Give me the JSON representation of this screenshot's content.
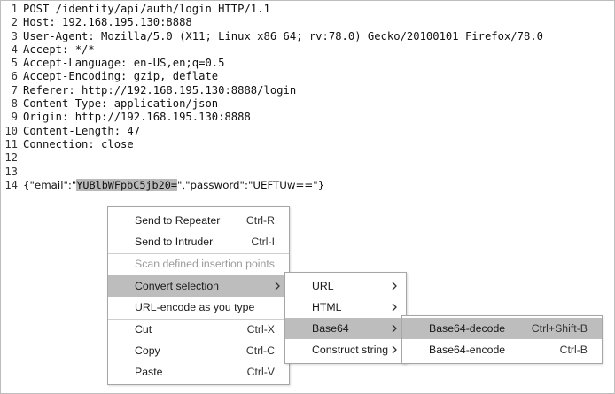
{
  "request_lines": [
    {
      "num": "1",
      "text": "POST /identity/api/auth/login HTTP/1.1"
    },
    {
      "num": "2",
      "text": "Host: 192.168.195.130:8888"
    },
    {
      "num": "3",
      "text": "User-Agent: Mozilla/5.0 (X11; Linux x86_64; rv:78.0) Gecko/20100101 Firefox/78.0"
    },
    {
      "num": "4",
      "text": "Accept: */*"
    },
    {
      "num": "5",
      "text": "Accept-Language: en-US,en;q=0.5"
    },
    {
      "num": "6",
      "text": "Accept-Encoding: gzip, deflate"
    },
    {
      "num": "7",
      "text": "Referer: http://192.168.195.130:8888/login"
    },
    {
      "num": "8",
      "text": "Content-Type: application/json"
    },
    {
      "num": "9",
      "text": "Origin: http://192.168.195.130:8888"
    },
    {
      "num": "10",
      "text": "Content-Length: 47"
    },
    {
      "num": "11",
      "text": "Connection: close"
    },
    {
      "num": "12",
      "text": ""
    },
    {
      "num": "13",
      "text": ""
    }
  ],
  "body_line": {
    "num": "14",
    "prefix": "{\"email\":\"",
    "selected": "YUBlbWFpbC5jb20=",
    "suffix": "\",\"password\":\"UEFTUw==\"}"
  },
  "context_menu": {
    "send_to_repeater": {
      "label": "Send to Repeater",
      "shortcut": "Ctrl-R"
    },
    "send_to_intruder": {
      "label": "Send to Intruder",
      "shortcut": "Ctrl-I"
    },
    "scan_insertion": {
      "label": "Scan defined insertion points"
    },
    "convert_selection": {
      "label": "Convert selection"
    },
    "url_encode_as_type": {
      "label": "URL-encode as you type"
    },
    "cut": {
      "label": "Cut",
      "shortcut": "Ctrl-X"
    },
    "copy": {
      "label": "Copy",
      "shortcut": "Ctrl-C"
    },
    "paste": {
      "label": "Paste",
      "shortcut": "Ctrl-V"
    }
  },
  "convert_submenu": {
    "url": {
      "label": "URL"
    },
    "html": {
      "label": "HTML"
    },
    "base64": {
      "label": "Base64"
    },
    "construct_string": {
      "label": "Construct string"
    }
  },
  "base64_submenu": {
    "decode": {
      "label": "Base64-decode",
      "shortcut": "Ctrl+Shift-B"
    },
    "encode": {
      "label": "Base64-encode",
      "shortcut": "Ctrl-B"
    }
  },
  "colors": {
    "highlight": "#bdbdbd",
    "selection": "#b9b9b9",
    "disabled_text": "#9a9a9a"
  }
}
